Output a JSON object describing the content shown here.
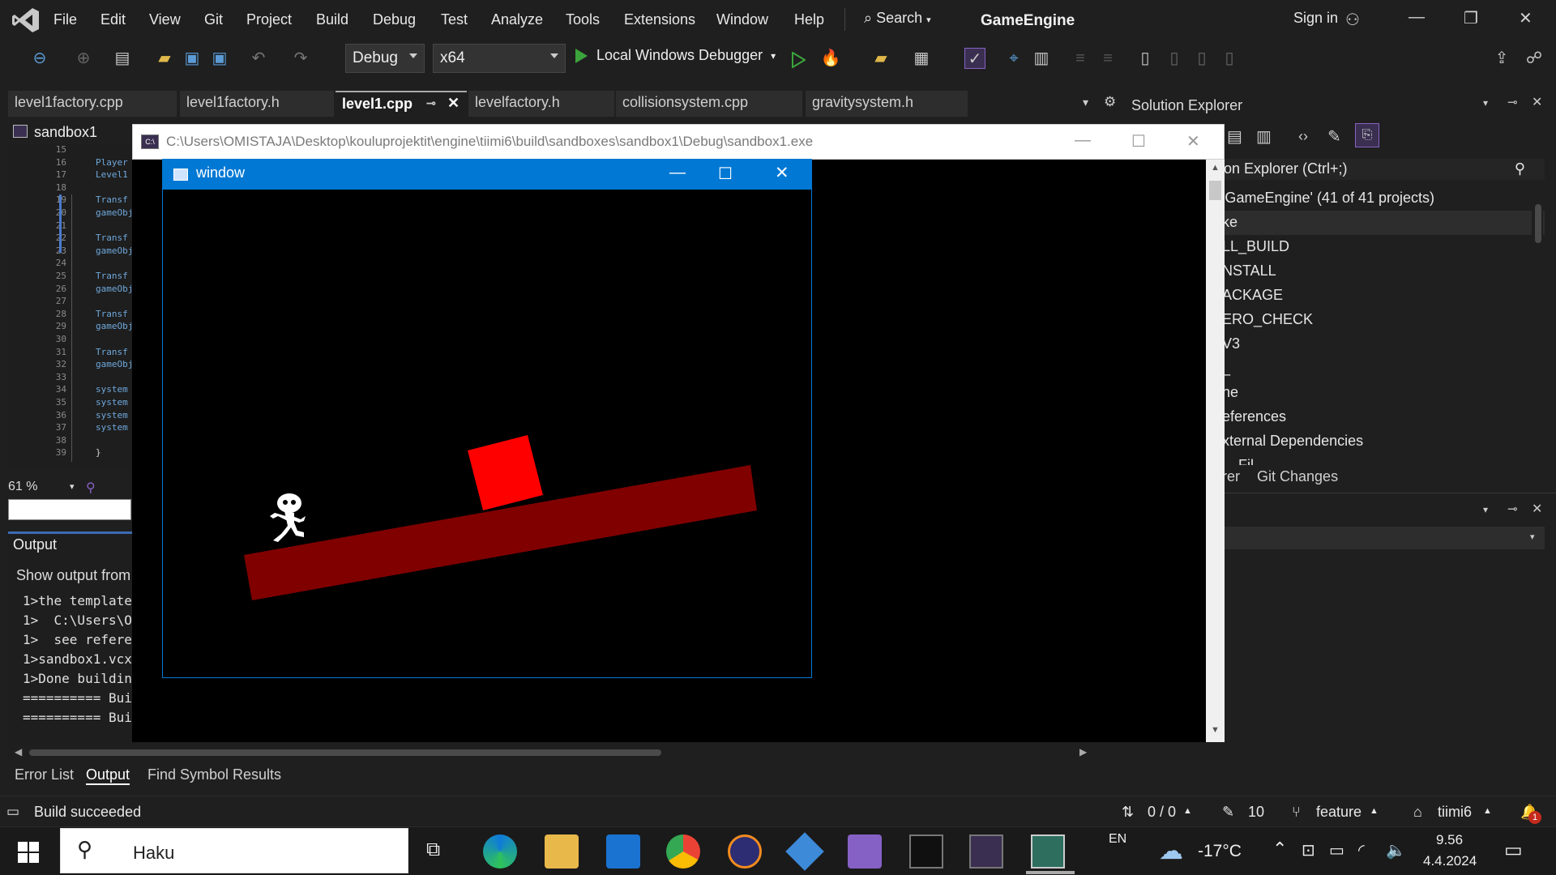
{
  "menubar": {
    "items": [
      "File",
      "Edit",
      "View",
      "Git",
      "Project",
      "Build",
      "Debug",
      "Test",
      "Analyze",
      "Tools",
      "Extensions",
      "Window",
      "Help"
    ],
    "search_label": "Search",
    "app_title": "GameEngine",
    "signin": "Sign in"
  },
  "toolbar": {
    "config": "Debug",
    "platform": "x64",
    "debugger": "Local Windows Debugger"
  },
  "tabs": [
    "level1factory.cpp",
    "level1factory.h",
    "level1.cpp",
    "levelfactory.h",
    "collisionsystem.cpp",
    "gravitysystem.h"
  ],
  "active_tab_index": 2,
  "editor": {
    "project": "sandbox1",
    "line_numbers": [
      "15",
      "16",
      "17",
      "18",
      "19",
      "20",
      "21",
      "22",
      "23",
      "24",
      "25",
      "26",
      "27",
      "28",
      "29",
      "30",
      "31",
      "32",
      "33",
      "34",
      "35",
      "36",
      "37",
      "38",
      "39"
    ],
    "code_lines": [
      "",
      "Player",
      "Level1",
      "",
      "Transf",
      "gameObj",
      "",
      "Transf",
      "gameObj",
      "",
      "Transf",
      "gameObj",
      "",
      "Transf",
      "gameObj",
      "",
      "Transf",
      "gameObj",
      "",
      "system",
      "system",
      "system",
      "system",
      "",
      "}"
    ],
    "zoom": "61 %"
  },
  "output": {
    "title": "Output",
    "show_from": "Show output from",
    "lines": [
      "1>the template",
      "1>  C:\\Users\\O",
      "1>  see refere",
      "1>sandbox1.vcx",
      "1>Done buildin",
      "========== Bui",
      "========== Bui"
    ]
  },
  "bottom_tabs": [
    "Error List",
    "Output",
    "Find Symbol Results"
  ],
  "statusbar": {
    "build": "Build succeeded",
    "errors": "0 / 0",
    "edits": "10",
    "branch": "feature",
    "repo": "tiimi6",
    "notifications": "1"
  },
  "solution_explorer": {
    "title": "Solution Explorer",
    "search": "on Explorer (Ctrl+;)",
    "items": [
      "'GameEngine' (41 of 41 projects)",
      "ke",
      "LL_BUILD",
      "NSTALL",
      "ACKAGE",
      "ERO_CHECK",
      "V3",
      "_",
      "ne",
      "eferences",
      "xternal Dependencies",
      "... Fil..."
    ],
    "tabs": [
      "rer",
      "Git Changes"
    ]
  },
  "console": {
    "title": "C:\\Users\\OMISTAJA\\Desktop\\kouluprojektit\\engine\\tiimi6\\build\\sandboxes\\sandbox1\\Debug\\sandbox1.exe"
  },
  "game_window": {
    "title": "window",
    "colors": {
      "platform": "#800000",
      "box": "#ff0000",
      "player": "#ffffff"
    }
  },
  "taskbar": {
    "search": "Haku",
    "language": "EN",
    "temperature": "-17°C",
    "time": "9.56",
    "date": "4.4.2024"
  },
  "colors": {
    "accent": "#0078d4",
    "vs_purple": "#8661c5"
  }
}
